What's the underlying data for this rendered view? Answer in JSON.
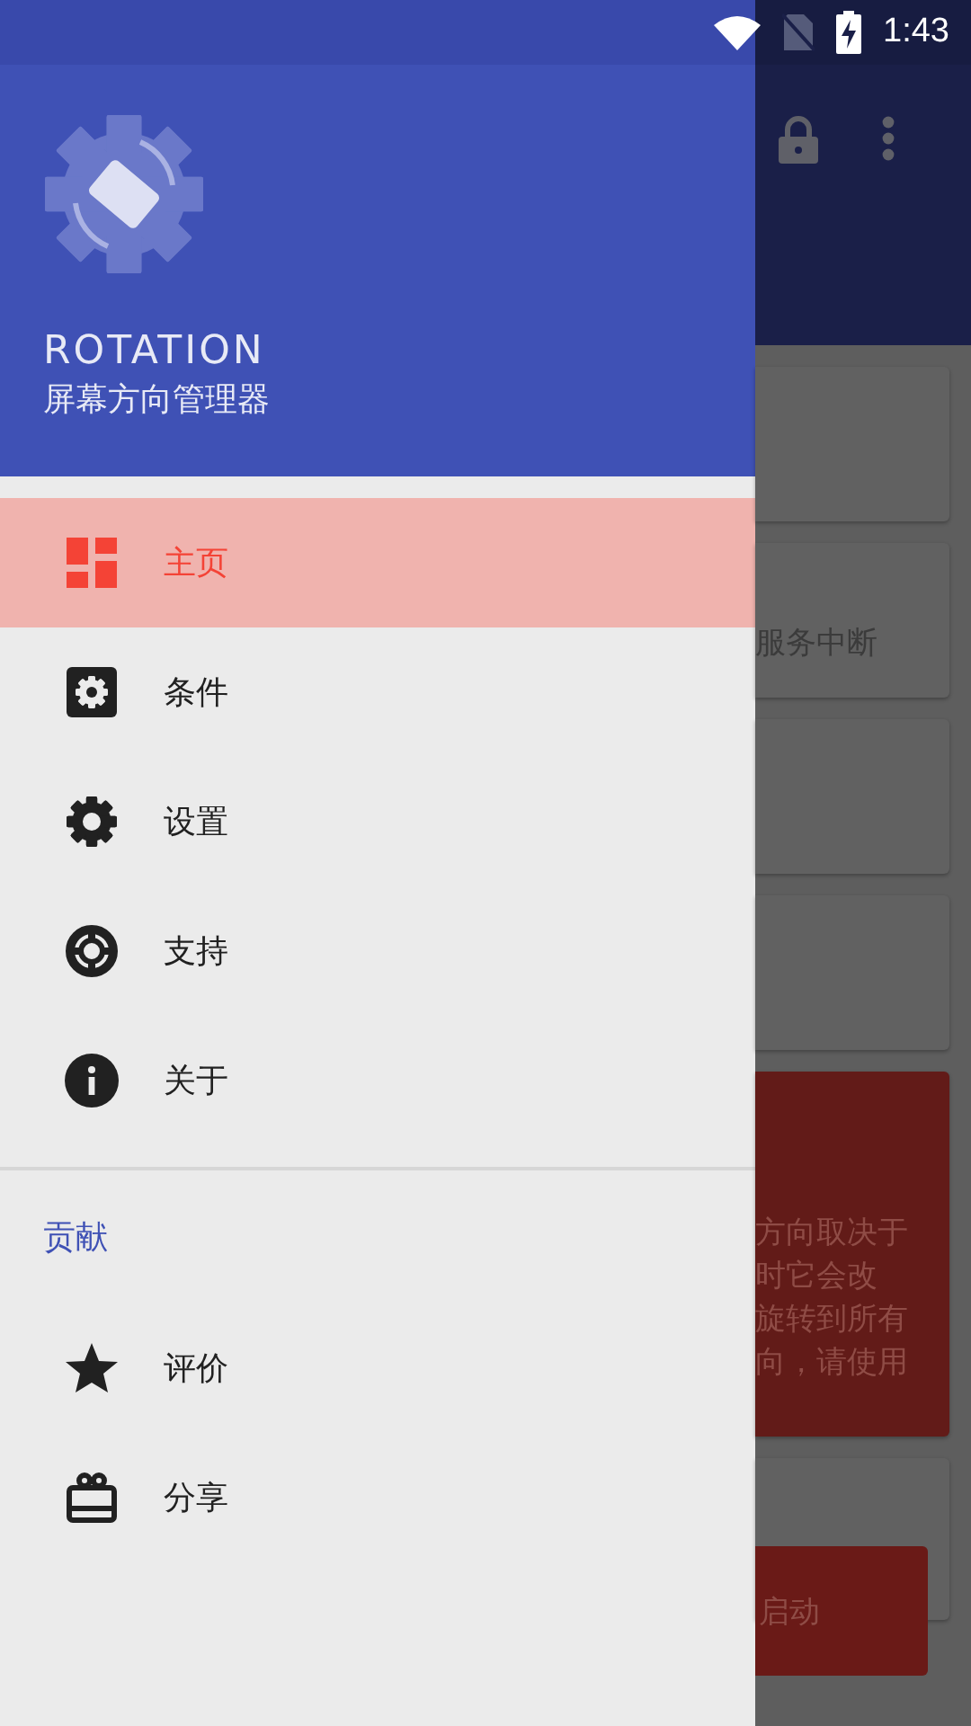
{
  "status_bar": {
    "time": "1:43"
  },
  "drawer": {
    "app_name": "ROTATION",
    "subtitle": "屏幕方向管理器",
    "items": [
      {
        "label": "主页",
        "kind": "dashboard",
        "selected": true
      },
      {
        "label": "条件",
        "kind": "conditions",
        "selected": false
      },
      {
        "label": "设置",
        "kind": "settings",
        "selected": false
      },
      {
        "label": "支持",
        "kind": "support",
        "selected": false
      },
      {
        "label": "关于",
        "kind": "about",
        "selected": false
      }
    ],
    "section": {
      "title": "贡献",
      "items": [
        {
          "label": "评价",
          "kind": "rate",
          "selected": false
        },
        {
          "label": "分享",
          "kind": "share",
          "selected": false
        }
      ]
    }
  },
  "background": {
    "cards": [
      {
        "kind": "plain"
      },
      {
        "kind": "plain",
        "lines": [
          "服务中断"
        ]
      },
      {
        "kind": "plain"
      },
      {
        "kind": "plain"
      },
      {
        "kind": "alert",
        "lines": [
          "方向取决于",
          "时它会改",
          "旋转到所有",
          "向，请使用"
        ]
      },
      {
        "kind": "action",
        "button": "启动"
      }
    ]
  }
}
